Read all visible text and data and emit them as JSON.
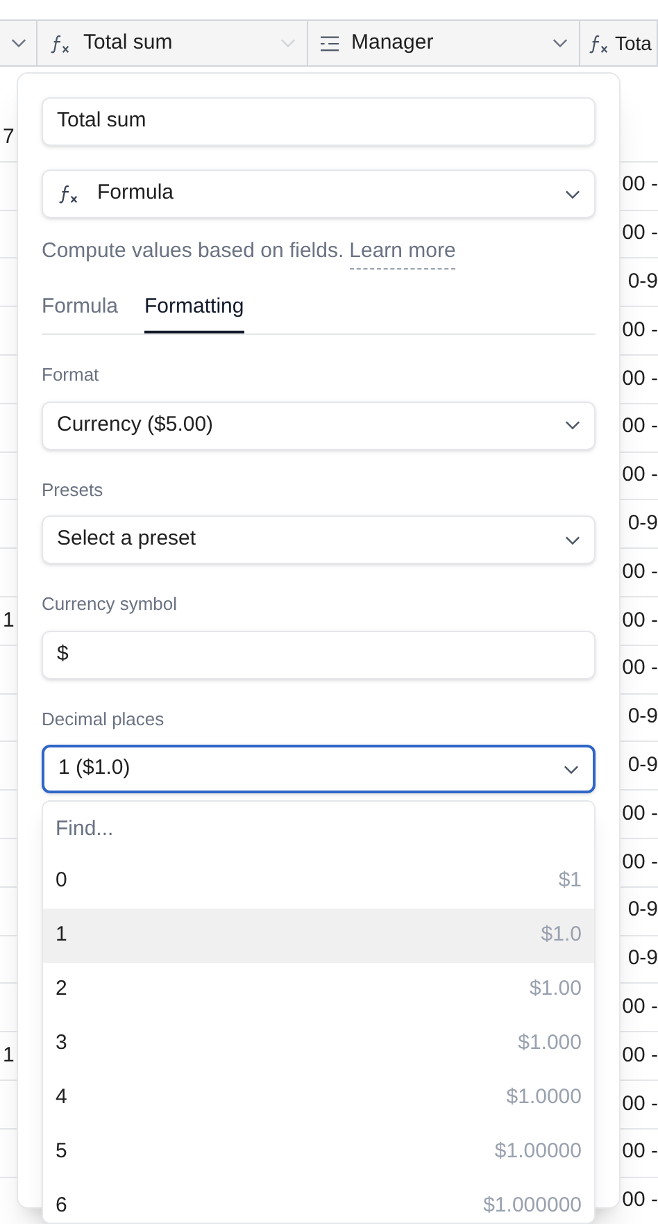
{
  "table": {
    "columns": [
      {
        "kind": "cut"
      },
      {
        "kind": "formula",
        "label": "Total sum"
      },
      {
        "kind": "list",
        "label": "Manager"
      },
      {
        "kind": "formula",
        "label": "Tota"
      }
    ],
    "rows": [
      {
        "column_1": "7",
        "column_4": ""
      },
      {
        "column_1": "",
        "column_4": "00 -"
      },
      {
        "column_1": "",
        "column_4": "00 -"
      },
      {
        "column_1": "",
        "column_4": "0-9"
      },
      {
        "column_1": "",
        "column_4": "00 -"
      },
      {
        "column_1": "",
        "column_4": "00 -"
      },
      {
        "column_1": "",
        "column_4": "00 -"
      },
      {
        "column_1": "",
        "column_4": "00 -"
      },
      {
        "column_1": "",
        "column_4": "0-9"
      },
      {
        "column_1": "",
        "column_4": "00 -"
      },
      {
        "column_1": "1",
        "column_4": "00 -"
      },
      {
        "column_1": "",
        "column_4": "00 -"
      },
      {
        "column_1": "",
        "column_4": "0-9"
      },
      {
        "column_1": "",
        "column_4": "0-9"
      },
      {
        "column_1": "",
        "column_4": "00 -"
      },
      {
        "column_1": "",
        "column_4": "00 -"
      },
      {
        "column_1": "",
        "column_4": "0-9"
      },
      {
        "column_1": "",
        "column_4": "0-9"
      },
      {
        "column_1": "",
        "column_4": "00 -"
      },
      {
        "column_1": "1",
        "column_4": "00 -"
      },
      {
        "column_1": "",
        "column_4": "00 -"
      },
      {
        "column_1": "",
        "column_4": "00 -"
      },
      {
        "column_1": "",
        "column_4": "00 -"
      }
    ]
  },
  "popover": {
    "field_name": "Total sum",
    "field_type": "Formula",
    "description": "Compute values based on fields.",
    "link": "Learn more",
    "tabs": [
      {
        "label": "Formula",
        "selected": false
      },
      {
        "label": "Formatting",
        "selected": true
      }
    ],
    "format": {
      "label": "Format",
      "value": "Currency ($5.00)"
    },
    "presets": {
      "label": "Presets",
      "value": "Select a preset"
    },
    "currency_symbol": {
      "label": "Currency symbol",
      "value": "$"
    },
    "decimal_places": {
      "label": "Decimal places",
      "value": "1 ($1.0)",
      "focused": true,
      "dropdown": {
        "placeholder": "Find...",
        "options": [
          {
            "label": "0",
            "example": "$1",
            "selected": false
          },
          {
            "label": "1",
            "example": "$1.0",
            "selected": true
          },
          {
            "label": "2",
            "example": "$1.00",
            "selected": false
          },
          {
            "label": "3",
            "example": "$1.000",
            "selected": false
          },
          {
            "label": "4",
            "example": "$1.0000",
            "selected": false
          },
          {
            "label": "5",
            "example": "$1.00000",
            "selected": false
          },
          {
            "label": "6",
            "example": "$1.000000",
            "selected": false
          }
        ]
      }
    }
  }
}
